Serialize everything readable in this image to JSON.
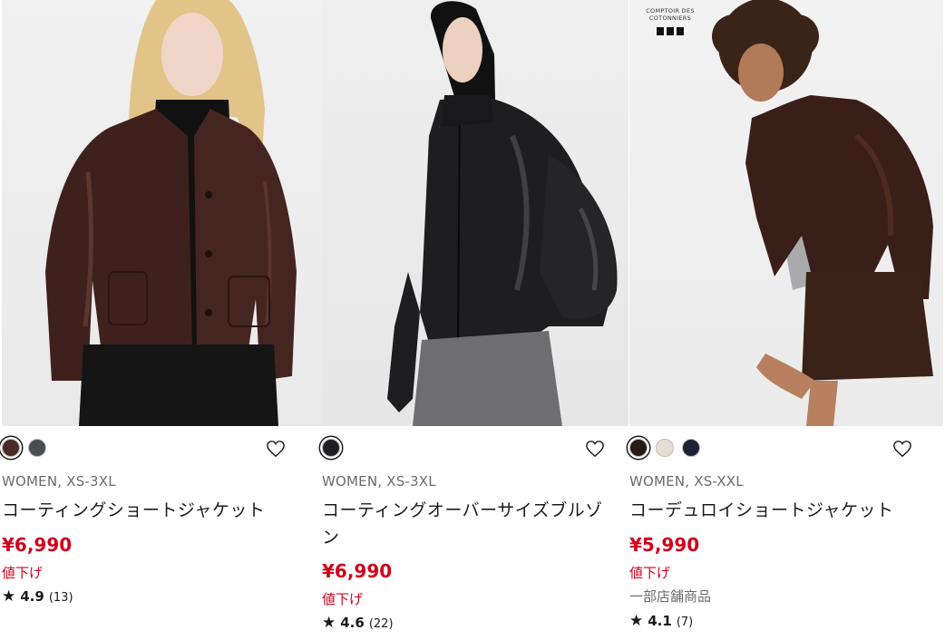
{
  "products": [
    {
      "image_label": "coating short jacket photo",
      "swatch_colors": [
        "#4a2b26",
        "#4a4d52"
      ],
      "selected_swatch": 0,
      "meta": "WOMEN, XS-3XL",
      "name": "コーティングショートジャケット",
      "price": "¥6,990",
      "tag": "値下げ",
      "rating": {
        "star": "★",
        "score": "4.9",
        "count": "(13)"
      }
    },
    {
      "image_label": "coating oversized blouson photo",
      "swatch_colors": [
        "#1f2024"
      ],
      "selected_swatch": 0,
      "meta": "WOMEN, XS-3XL",
      "name": "コーティングオーバーサイズブルゾン",
      "price": "¥6,990",
      "tag": "値下げ",
      "rating": {
        "star": "★",
        "score": "4.6",
        "count": "(22)"
      }
    },
    {
      "image_label": "corduroy short jacket photo",
      "brand_logo": "COMPTOIR DES COTONNIERS",
      "swatch_colors": [
        "#2a1a16",
        "#e5ddd2",
        "#1b2233"
      ],
      "selected_swatch": 0,
      "meta": "WOMEN, XS-XXL",
      "name": "コーデュロイショートジャケット",
      "price": "¥5,990",
      "tag": "値下げ",
      "store_note": "一部店舗商品",
      "rating": {
        "star": "★",
        "score": "4.1",
        "count": "(7)"
      }
    }
  ],
  "icons": {
    "favorite": "heart-outline-icon"
  },
  "colors": {
    "price": "#d1001c",
    "text": "#1b1b1b",
    "meta": "#6b6b6b"
  }
}
